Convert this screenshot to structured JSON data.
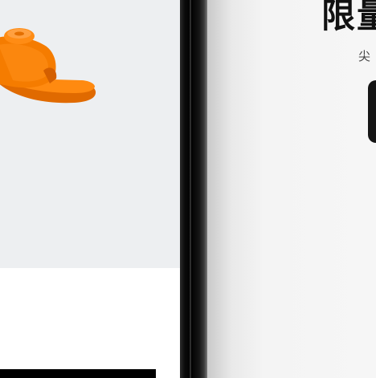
{
  "left_screen": {
    "product_icon": "orange-slide-sandal"
  },
  "right_screen": {
    "headline": "限量",
    "subline": "尖"
  },
  "colors": {
    "product_bg": "#edeff1",
    "sandal": "#f57c00",
    "headline": "#111111",
    "button": "#151515"
  }
}
